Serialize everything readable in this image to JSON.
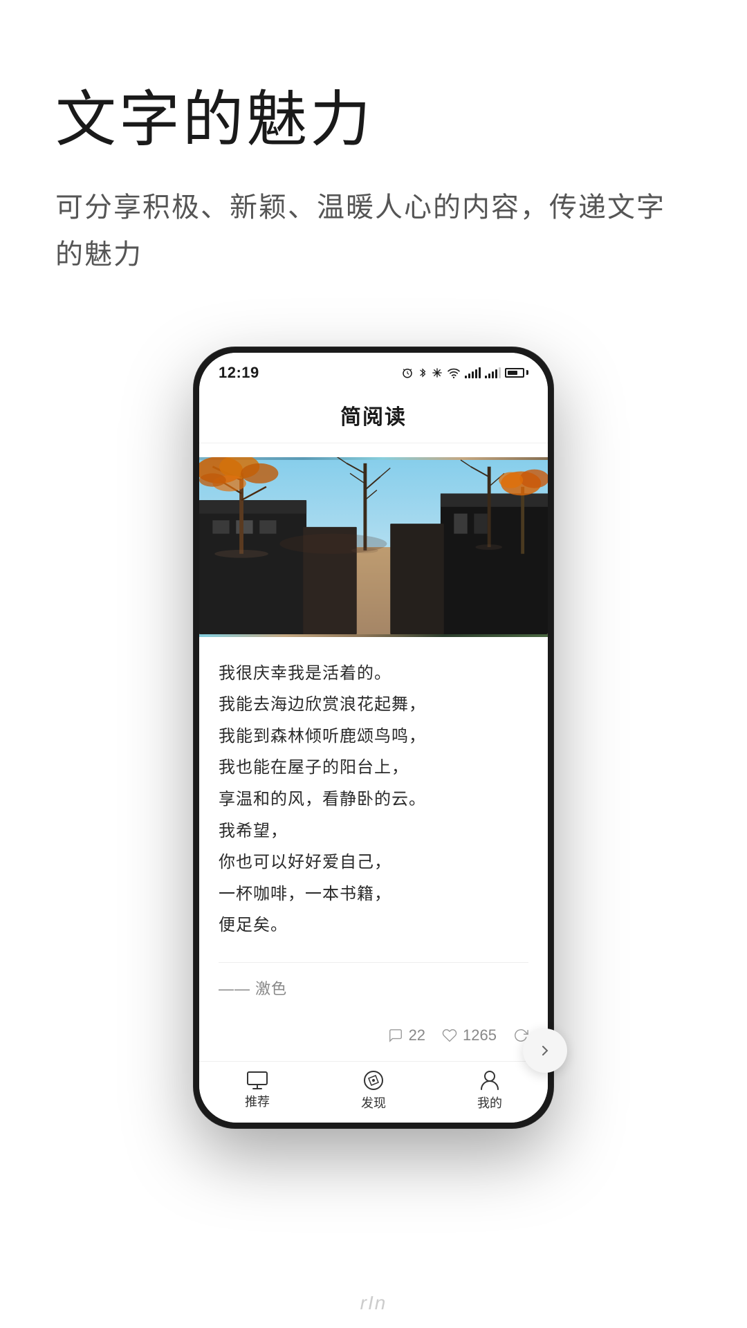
{
  "page": {
    "background": "#ffffff"
  },
  "header": {
    "main_title": "文字的魅力",
    "subtitle": "可分享积极、新颖、温暖人心的内容，传递文字的魅力"
  },
  "phone": {
    "status_bar": {
      "time": "12:19",
      "nfc_icon": "N",
      "icons": "⏰ ✱ ❄ ▲ 4G 4G"
    },
    "app_title": "简阅读",
    "article": {
      "text_lines": [
        "我很庆幸我是活着的。",
        "我能去海边欣赏浪花起舞，",
        "我能到森林倾听鹿颂鸟鸣，",
        "我也能在屋子的阳台上，",
        "享温和的风，看静卧的云。",
        "我希望，",
        "你也可以好好爱自己，",
        "一杯咖啡，一本书籍，",
        "便足矣。"
      ],
      "author": "—— 激色",
      "comment_count": "22",
      "like_count": "1265"
    },
    "bottom_nav": {
      "items": [
        {
          "label": "推荐",
          "icon": "monitor"
        },
        {
          "label": "发现",
          "icon": "compass"
        },
        {
          "label": "我的",
          "icon": "user"
        }
      ]
    }
  },
  "bottom_brand": "rIn"
}
